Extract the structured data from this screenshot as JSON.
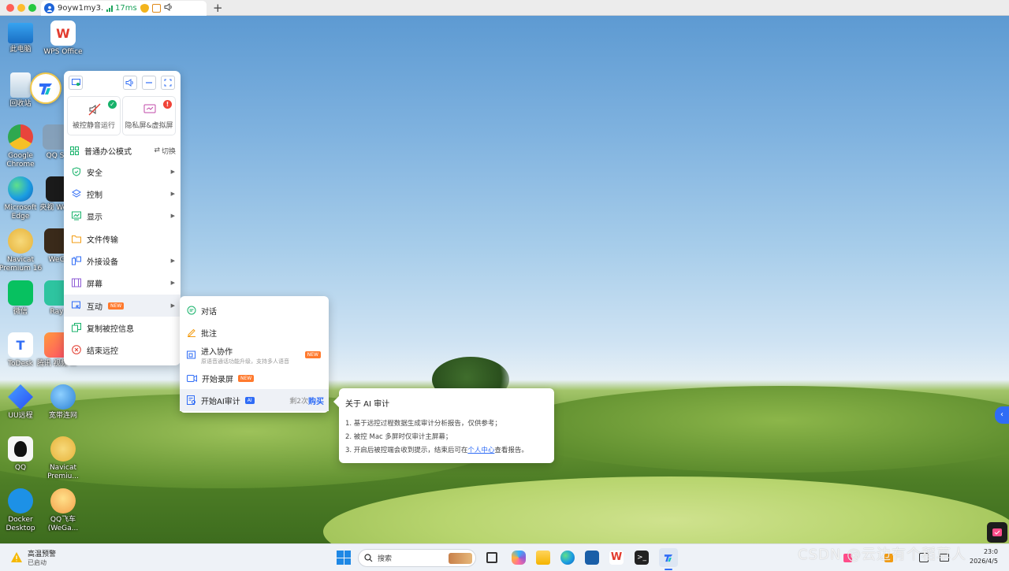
{
  "titlebar": {
    "tab_title": "9oyw1my3...",
    "latency": "17ms",
    "new_tab_label": "+",
    "colors": {
      "close": "#ff5f57",
      "minimize": "#febc2e",
      "zoom": "#28c840"
    }
  },
  "desktop_icons": [
    {
      "label": "此电脑",
      "icon": "computer-icon",
      "color": "#2f8fe0"
    },
    {
      "label": "WPS Office",
      "icon": "wps-icon",
      "color": "#e23b2e"
    },
    {
      "label": "回收站",
      "icon": "recycle-bin-icon",
      "color": "#d8e7f2"
    },
    {
      "label": "Google Chrome",
      "icon": "chrome-icon",
      "color": "#e8453c"
    },
    {
      "label": "QQ S",
      "icon": "app-icon",
      "color": "#6a7b8c"
    },
    {
      "label": "Microsoft Edge",
      "icon": "edge-icon",
      "color": "#1b9de2"
    },
    {
      "label": "央视 WeGa",
      "icon": "game-icon",
      "color": "#1a1a1a"
    },
    {
      "label": "Navicat Premium 16",
      "icon": "navicat-icon",
      "color": "#f0c24a"
    },
    {
      "label": "WeG",
      "icon": "game-icon",
      "color": "#3a2a1a"
    },
    {
      "label": "微信",
      "icon": "wechat-icon",
      "color": "#07c160"
    },
    {
      "label": "Ray",
      "icon": "app-icon",
      "color": "#2ec4a0"
    },
    {
      "label": "ToDesk",
      "icon": "todesk-icon",
      "color": "#2f6cf6"
    },
    {
      "label": "腾讯 视频 ...",
      "icon": "video-icon",
      "color": "#ff4d6a"
    },
    {
      "label": "UU远程",
      "icon": "uu-icon",
      "color": "#2a6cf6"
    },
    {
      "label": "宽带连网",
      "icon": "globe-icon",
      "color": "#2a7fd4"
    },
    {
      "label": "QQ",
      "icon": "qq-icon",
      "color": "#f6f6f6"
    },
    {
      "label": "Navicat Premiu...",
      "icon": "navicat-icon",
      "color": "#f0c24a"
    },
    {
      "label": "Docker Desktop",
      "icon": "docker-icon",
      "color": "#1d91e6"
    },
    {
      "label": "QQ飞车 (WeGa...",
      "icon": "qqspeed-icon",
      "color": "#f3c04a"
    }
  ],
  "toolbar": {
    "cards": [
      {
        "label": "被控静音运行",
        "icon": "mute-icon",
        "badge": "✓"
      },
      {
        "label": "隐私屏&虚拟屏",
        "icon": "privacy-screen-icon",
        "badge": "!"
      }
    ],
    "mode": {
      "label": "普通办公模式",
      "switch_label": "切换"
    },
    "menu_items": [
      {
        "label": "安全",
        "icon": "shield-icon",
        "has_submenu": true
      },
      {
        "label": "控制",
        "icon": "control-icon",
        "has_submenu": true
      },
      {
        "label": "显示",
        "icon": "display-icon",
        "has_submenu": true
      },
      {
        "label": "文件传输",
        "icon": "folder-icon",
        "has_submenu": false
      },
      {
        "label": "外接设备",
        "icon": "devices-icon",
        "has_submenu": true
      },
      {
        "label": "屏幕",
        "icon": "screen-icon",
        "has_submenu": true
      },
      {
        "label": "互动",
        "icon": "interaction-icon",
        "has_submenu": true,
        "tag": "NEW"
      },
      {
        "label": "复制被控信息",
        "icon": "copy-icon",
        "has_submenu": false
      },
      {
        "label": "结束远控",
        "icon": "end-icon",
        "has_submenu": false
      }
    ]
  },
  "submenu": {
    "items": [
      {
        "label": "对话",
        "icon": "chat-icon"
      },
      {
        "label": "批注",
        "icon": "annotate-icon"
      },
      {
        "label": "进入协作",
        "sub": "原语音通话功能升级，支持多人语音",
        "tag": "NEW",
        "icon": "collab-icon"
      },
      {
        "label": "开始录屏",
        "tag": "NEW",
        "icon": "record-icon"
      },
      {
        "label": "开始AI审计",
        "tag": "AI",
        "remain": "剩2次",
        "buy": "购买",
        "icon": "ai-audit-icon"
      }
    ]
  },
  "tooltip": {
    "title": "关于 AI 审计",
    "line1": "1. 基于远控过程数据生成审计分析报告，仅供参考；",
    "line2": "2. 被控 Mac 多屏时仅审计主屏幕；",
    "line3_pre": "3. 开启后被控端会收到提示，结束后可在",
    "line3_link": "个人中心",
    "line3_post": "查看报告。"
  },
  "side_handle": "‹",
  "taskbar": {
    "weather_title": "高温预警",
    "weather_sub": "已启动",
    "search_label": "搜索",
    "clock_time": "23:0",
    "clock_date": "2026/4/5"
  },
  "watermark": "CSDN @云边有个稻草人"
}
